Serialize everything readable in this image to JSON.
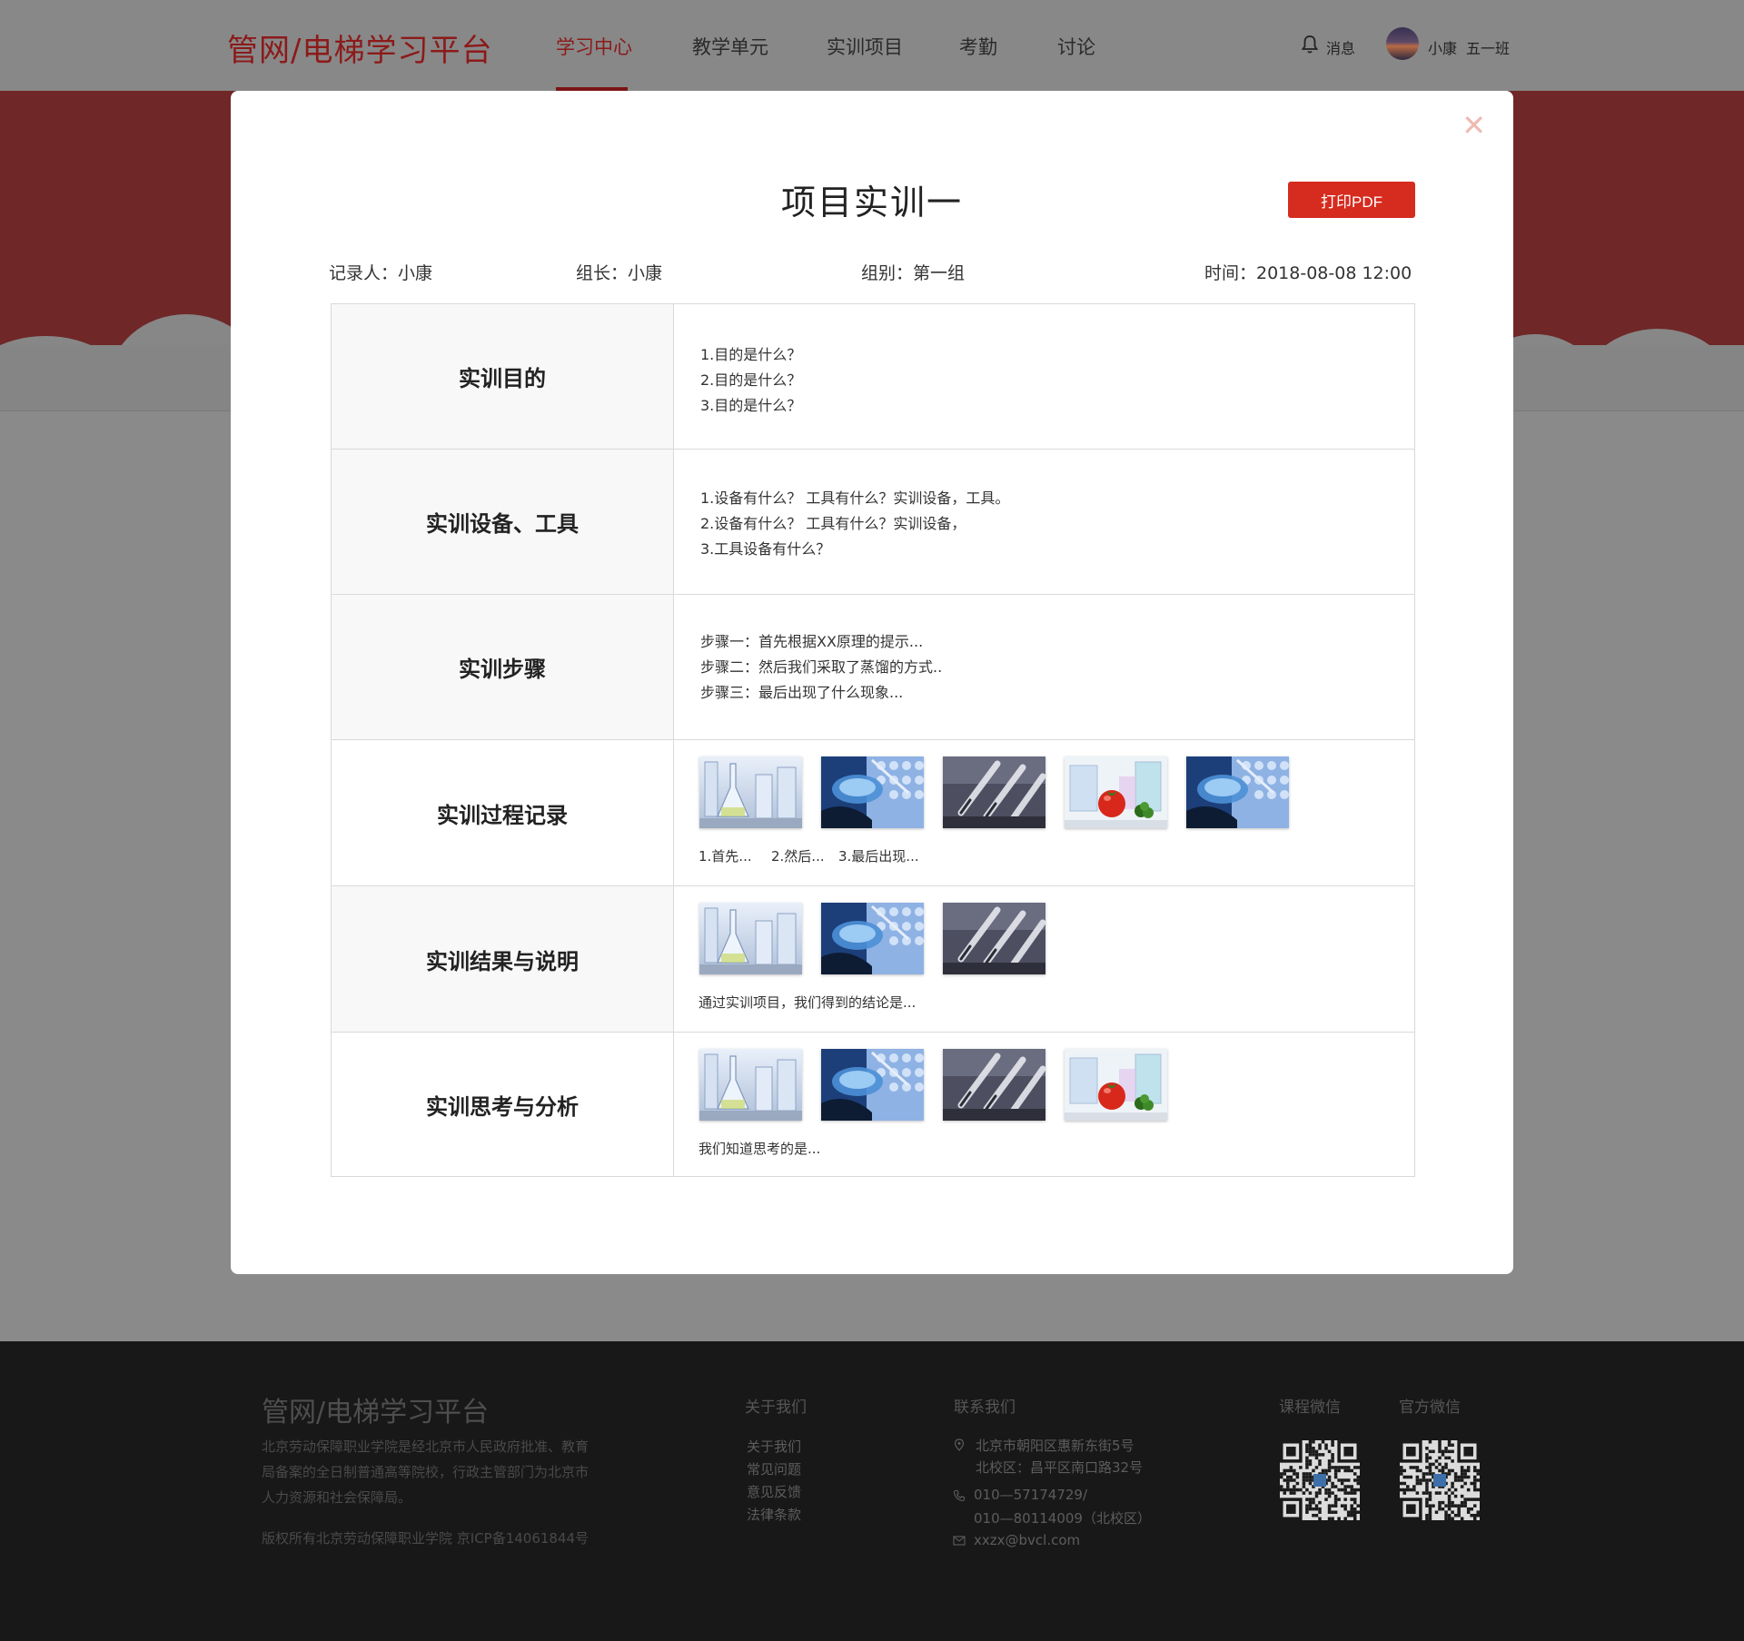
{
  "header": {
    "logo": "管网/电梯学习平台",
    "nav": [
      "学习中心",
      "教学单元",
      "实训项目",
      "考勤",
      "讨论"
    ],
    "active_nav": "学习中心",
    "message_label": "消息",
    "user_name": "小康",
    "user_class": "五一班"
  },
  "modal": {
    "title": "项目实训一",
    "print_label": "打印PDF",
    "close_icon": "close-icon",
    "recorder": "记录人：小康",
    "leader": "组长：小康",
    "group": "组别：第一组",
    "time": "时间：2018-08-08 12:00",
    "rows": [
      {
        "label": "实训目的",
        "lines": [
          "1.目的是什么？",
          "2.目的是什么？",
          "3.目的是什么？"
        ]
      },
      {
        "label": "实训设备、工具",
        "lines": [
          "1.设备有什么？ 工具有什么？实训设备，工具。",
          "2.设备有什么？ 工具有什么？实训设备，",
          "3.工具设备有什么？"
        ]
      },
      {
        "label": "实训步骤",
        "lines": [
          "步骤一：首先根据XX原理的提示...",
          "步骤二：然后我们采取了蒸馏的方式..",
          "步骤三：最后出现了什么现象..."
        ]
      },
      {
        "label": "实训过程记录",
        "images": [
          "flasks",
          "petri-dish",
          "test-tubes",
          "tomato",
          "petri-dish"
        ],
        "captions": [
          "1.首先...",
          "2.然后...",
          "3.最后出现..."
        ]
      },
      {
        "label": "实训结果与说明",
        "images": [
          "flasks",
          "petri-dish",
          "test-tubes"
        ],
        "note": "通过实训项目，我们得到的结论是..."
      },
      {
        "label": "实训思考与分析",
        "images": [
          "flasks",
          "petri-dish",
          "test-tubes",
          "tomato"
        ],
        "note": "我们知道思考的是..."
      }
    ]
  },
  "footer": {
    "logo": "管网/电梯学习平台",
    "description": [
      "北京劳动保障职业学院是经北京市人民政府批准、教育",
      "局备案的全日制普通高等院校，行政主管部门为北京市",
      "人力资源和社会保障局。"
    ],
    "copyright": "版权所有北京劳动保障职业学院    京ICP备14061844号",
    "about_title": "关于我们",
    "about_links": [
      "关于我们",
      "常见问题",
      "意见反馈",
      "法律条款"
    ],
    "contact_title": "联系我们",
    "address": [
      "北京市朝阳区惠新东街5号",
      "北校区：昌平区南口路32号"
    ],
    "phone": [
      "010—57174729/",
      "010—80114009（北校区）"
    ],
    "email": "xxzx@bvcl.com",
    "qr_course_title": "课程微信",
    "qr_official_title": "官方微信"
  },
  "colors": {
    "brand_red": "#d62b1f",
    "dark_red": "#8c1a1a",
    "close_pink": "#f0b9b2"
  }
}
